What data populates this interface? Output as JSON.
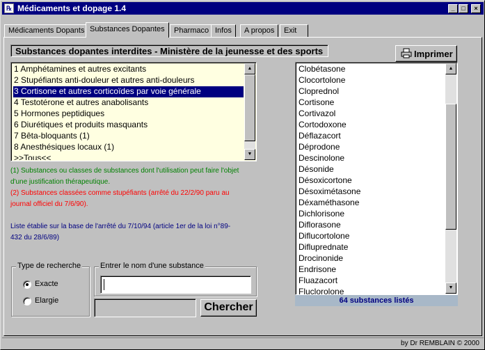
{
  "window": {
    "title": "Médicaments et dopage 1.4",
    "icon": "app-icon",
    "controls": {
      "minimize": "_",
      "maximize": "□",
      "close": "×"
    }
  },
  "tabs": [
    {
      "label": "Médicaments Dopants"
    },
    {
      "label": "Substances Dopantes",
      "active": true
    },
    {
      "label": "Pharmaco"
    },
    {
      "label": "Infos"
    },
    {
      "label": "A propos"
    },
    {
      "label": "Exit"
    }
  ],
  "main": {
    "section_title": "Substances dopantes interdites - Ministère de la jeunesse et des sports",
    "print_button": "Imprimer",
    "categories": [
      "1 Amphétamines et autres excitants",
      "2 Stupéfiants anti-douleur et autres anti-douleurs",
      "3 Cortisone et autres corticoïdes par voie générale",
      "4 Testotérone et autres anabolisants",
      "5 Hormones peptidiques",
      "6 Diurétiques et produits masquants",
      "7 Bêta-bloquants (1)",
      "8 Anesthésiques locaux (1)",
      ">>Tous<<"
    ],
    "selected_category_index": 2,
    "notes": {
      "green": "(1) Substances ou classes de substances dont l'utilisation peut faire l'objet d'une justification thérapeutique.",
      "red": "(2) Substances classées comme stupéfiants (arrêté du 22/2/90 paru au journal officiel du 7/6/90).",
      "blue": "Liste établie sur la base de l'arrêté du 7/10/94 (article 1er de la loi n°89-432 du 28/6/89)"
    },
    "search_type": {
      "label": "Type de recherche",
      "options": [
        "Exacte",
        "Elargie"
      ],
      "selected": "Exacte"
    },
    "name_input": {
      "label": "Entrer le nom d'une substance",
      "value": ""
    },
    "search_button": "Chercher",
    "substances": [
      "Clobétasone",
      "Clocortolone",
      "Cloprednol",
      "Cortisone",
      "Cortivazol",
      "Cortodoxone",
      "Déflazacort",
      "Déprodone",
      "Descinolone",
      "Désonide",
      "Désoxicortone",
      "Désoximétasone",
      "Déxaméthasone",
      "Dichlorisone",
      "Diflorasone",
      "Diflucortolone",
      "Difluprednate",
      "Drocinonide",
      "Endrisone",
      "Fluazacort",
      "Fluclorolone"
    ],
    "count_label": "64 substances listés"
  },
  "footer": {
    "credit": "by Dr REMBLAIN © 2000"
  },
  "colors": {
    "titlebar": "#000080",
    "list_bg": "#ffffe1",
    "selection": "#000080",
    "note_green": "#008000",
    "note_red": "#ff0000",
    "note_blue": "#000080",
    "count_bar": "#a8b8c8"
  }
}
